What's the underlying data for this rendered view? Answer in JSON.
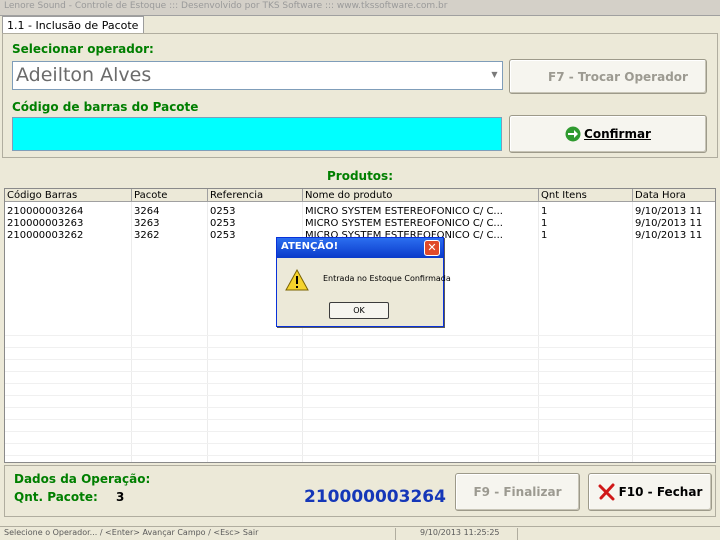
{
  "window": {
    "title": "Lenore Sound - Controle de Estoque ::: Desenvolvido por TKS Software ::: www.tkssoftware.com.br"
  },
  "tab": {
    "label": "1.1 - Inclusão de Pacote"
  },
  "operator": {
    "label": "Selecionar operador:",
    "value": "Adeilton Alves"
  },
  "change_operator_button": {
    "label": "F7 - Trocar Operador"
  },
  "barcode": {
    "label": "Código de barras do Pacote",
    "value": ""
  },
  "confirm_button": {
    "label": "Confirmar"
  },
  "products": {
    "title": "Produtos:",
    "columns": [
      "Código Barras",
      "Pacote",
      "Referencia",
      "Nome do produto",
      "Qnt Itens",
      "Data Hora"
    ],
    "rows": [
      [
        "210000003264",
        "3264",
        "0253",
        "MICRO SYSTEM ESTEREOFONICO C/ C...",
        "1",
        "9/10/2013 11"
      ],
      [
        "210000003263",
        "3263",
        "0253",
        "MICRO SYSTEM ESTEREOFONICO C/ C...",
        "1",
        "9/10/2013 11"
      ],
      [
        "210000003262",
        "3262",
        "0253",
        "MICRO SYSTEM ESTEREOFONICO C/ C...",
        "1",
        "9/10/2013 11"
      ]
    ]
  },
  "dialog": {
    "title": "ATENÇÃO!",
    "message": "Entrada no Estoque Confirmada",
    "ok_label": "OK"
  },
  "operation": {
    "title": "Dados da Operação:",
    "qnt_label": "Qnt. Pacote:",
    "qnt_value": "3",
    "last_barcode": "210000003264"
  },
  "finalize_button": {
    "label": "F9 - Finalizar"
  },
  "close_button": {
    "label": "F10 - Fechar"
  },
  "statusbar": {
    "hint": "Selecione o Operador... / <Enter> Avançar Campo / <Esc> Sair",
    "datetime": "9/10/2013 11:25:25"
  },
  "colors": {
    "label_green": "#007f00",
    "barcode_input_bg": "#00ffff",
    "barcode_display": "#1537b8"
  },
  "icons": {
    "confirm": "green-arrow-icon",
    "close": "red-x-icon",
    "dialog": "warning-icon"
  }
}
